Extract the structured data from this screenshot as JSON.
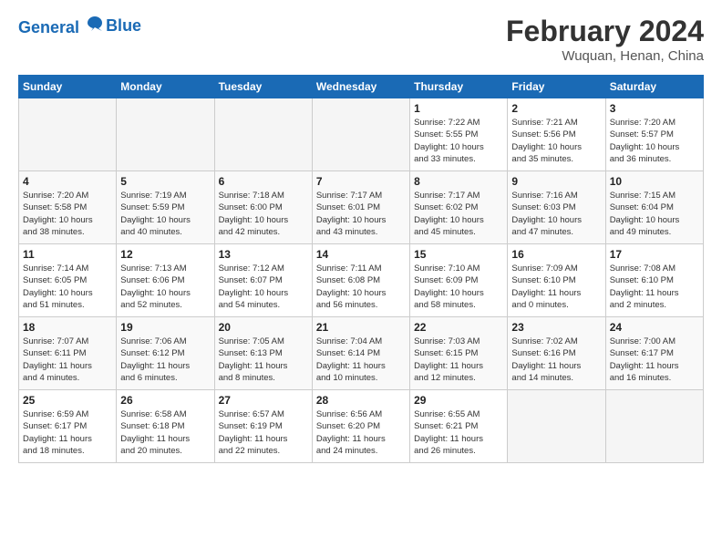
{
  "logo": {
    "line1": "General",
    "line2": "Blue"
  },
  "title": "February 2024",
  "subtitle": "Wuquan, Henan, China",
  "days_of_week": [
    "Sunday",
    "Monday",
    "Tuesday",
    "Wednesday",
    "Thursday",
    "Friday",
    "Saturday"
  ],
  "weeks": [
    [
      {
        "day": "",
        "info": ""
      },
      {
        "day": "",
        "info": ""
      },
      {
        "day": "",
        "info": ""
      },
      {
        "day": "",
        "info": ""
      },
      {
        "day": "1",
        "info": "Sunrise: 7:22 AM\nSunset: 5:55 PM\nDaylight: 10 hours\nand 33 minutes."
      },
      {
        "day": "2",
        "info": "Sunrise: 7:21 AM\nSunset: 5:56 PM\nDaylight: 10 hours\nand 35 minutes."
      },
      {
        "day": "3",
        "info": "Sunrise: 7:20 AM\nSunset: 5:57 PM\nDaylight: 10 hours\nand 36 minutes."
      }
    ],
    [
      {
        "day": "4",
        "info": "Sunrise: 7:20 AM\nSunset: 5:58 PM\nDaylight: 10 hours\nand 38 minutes."
      },
      {
        "day": "5",
        "info": "Sunrise: 7:19 AM\nSunset: 5:59 PM\nDaylight: 10 hours\nand 40 minutes."
      },
      {
        "day": "6",
        "info": "Sunrise: 7:18 AM\nSunset: 6:00 PM\nDaylight: 10 hours\nand 42 minutes."
      },
      {
        "day": "7",
        "info": "Sunrise: 7:17 AM\nSunset: 6:01 PM\nDaylight: 10 hours\nand 43 minutes."
      },
      {
        "day": "8",
        "info": "Sunrise: 7:17 AM\nSunset: 6:02 PM\nDaylight: 10 hours\nand 45 minutes."
      },
      {
        "day": "9",
        "info": "Sunrise: 7:16 AM\nSunset: 6:03 PM\nDaylight: 10 hours\nand 47 minutes."
      },
      {
        "day": "10",
        "info": "Sunrise: 7:15 AM\nSunset: 6:04 PM\nDaylight: 10 hours\nand 49 minutes."
      }
    ],
    [
      {
        "day": "11",
        "info": "Sunrise: 7:14 AM\nSunset: 6:05 PM\nDaylight: 10 hours\nand 51 minutes."
      },
      {
        "day": "12",
        "info": "Sunrise: 7:13 AM\nSunset: 6:06 PM\nDaylight: 10 hours\nand 52 minutes."
      },
      {
        "day": "13",
        "info": "Sunrise: 7:12 AM\nSunset: 6:07 PM\nDaylight: 10 hours\nand 54 minutes."
      },
      {
        "day": "14",
        "info": "Sunrise: 7:11 AM\nSunset: 6:08 PM\nDaylight: 10 hours\nand 56 minutes."
      },
      {
        "day": "15",
        "info": "Sunrise: 7:10 AM\nSunset: 6:09 PM\nDaylight: 10 hours\nand 58 minutes."
      },
      {
        "day": "16",
        "info": "Sunrise: 7:09 AM\nSunset: 6:10 PM\nDaylight: 11 hours\nand 0 minutes."
      },
      {
        "day": "17",
        "info": "Sunrise: 7:08 AM\nSunset: 6:10 PM\nDaylight: 11 hours\nand 2 minutes."
      }
    ],
    [
      {
        "day": "18",
        "info": "Sunrise: 7:07 AM\nSunset: 6:11 PM\nDaylight: 11 hours\nand 4 minutes."
      },
      {
        "day": "19",
        "info": "Sunrise: 7:06 AM\nSunset: 6:12 PM\nDaylight: 11 hours\nand 6 minutes."
      },
      {
        "day": "20",
        "info": "Sunrise: 7:05 AM\nSunset: 6:13 PM\nDaylight: 11 hours\nand 8 minutes."
      },
      {
        "day": "21",
        "info": "Sunrise: 7:04 AM\nSunset: 6:14 PM\nDaylight: 11 hours\nand 10 minutes."
      },
      {
        "day": "22",
        "info": "Sunrise: 7:03 AM\nSunset: 6:15 PM\nDaylight: 11 hours\nand 12 minutes."
      },
      {
        "day": "23",
        "info": "Sunrise: 7:02 AM\nSunset: 6:16 PM\nDaylight: 11 hours\nand 14 minutes."
      },
      {
        "day": "24",
        "info": "Sunrise: 7:00 AM\nSunset: 6:17 PM\nDaylight: 11 hours\nand 16 minutes."
      }
    ],
    [
      {
        "day": "25",
        "info": "Sunrise: 6:59 AM\nSunset: 6:17 PM\nDaylight: 11 hours\nand 18 minutes."
      },
      {
        "day": "26",
        "info": "Sunrise: 6:58 AM\nSunset: 6:18 PM\nDaylight: 11 hours\nand 20 minutes."
      },
      {
        "day": "27",
        "info": "Sunrise: 6:57 AM\nSunset: 6:19 PM\nDaylight: 11 hours\nand 22 minutes."
      },
      {
        "day": "28",
        "info": "Sunrise: 6:56 AM\nSunset: 6:20 PM\nDaylight: 11 hours\nand 24 minutes."
      },
      {
        "day": "29",
        "info": "Sunrise: 6:55 AM\nSunset: 6:21 PM\nDaylight: 11 hours\nand 26 minutes."
      },
      {
        "day": "",
        "info": ""
      },
      {
        "day": "",
        "info": ""
      }
    ]
  ]
}
